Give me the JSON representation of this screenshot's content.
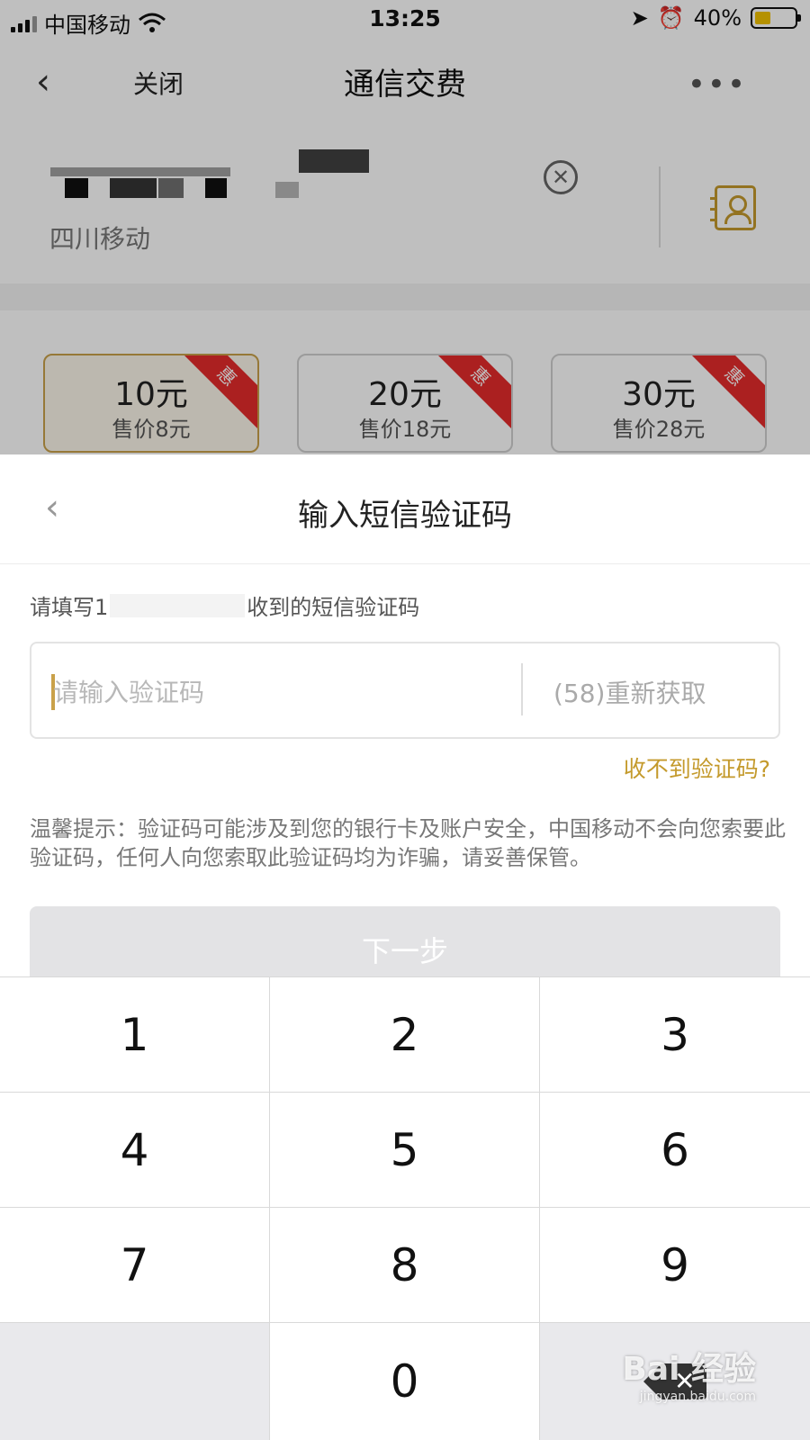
{
  "status_bar": {
    "carrier": "中国移动",
    "time": "13:25",
    "battery": "40%",
    "battery_level": 0.4
  },
  "nav": {
    "close_label": "关闭",
    "title": "通信交费",
    "more_label": "•••"
  },
  "phone": {
    "carrier_label": "四川移动"
  },
  "amounts": [
    {
      "value": "10元",
      "price": "售价8元",
      "badge": "惠",
      "selected": true
    },
    {
      "value": "20元",
      "price": "售价18元",
      "badge": "惠",
      "selected": false
    },
    {
      "value": "30元",
      "price": "售价28元",
      "badge": "惠",
      "selected": false
    }
  ],
  "modal": {
    "title": "输入短信验证码",
    "hint_prefix": "请填写1",
    "hint_suffix": "收到的短信验证码",
    "input_placeholder": "请输入验证码",
    "resend_label": "(58)重新获取",
    "cant_receive": "收不到验证码?",
    "tip": "温馨提示：验证码可能涉及到您的银行卡及账户安全，中国移动不会向您索要此验证码，任何人向您索取此验证码均为诈骗，请妥善保管。",
    "next_label": "下一步"
  },
  "keypad": {
    "keys": [
      "1",
      "2",
      "3",
      "4",
      "5",
      "6",
      "7",
      "8",
      "9",
      "",
      "0",
      "delete"
    ]
  },
  "watermark": {
    "brand": "Bai 经验",
    "url": "jingyan.baidu.com"
  },
  "colors": {
    "accent": "#c49a2c",
    "badge": "#e52b2b",
    "keypad_gray": "#e9e9ec"
  }
}
